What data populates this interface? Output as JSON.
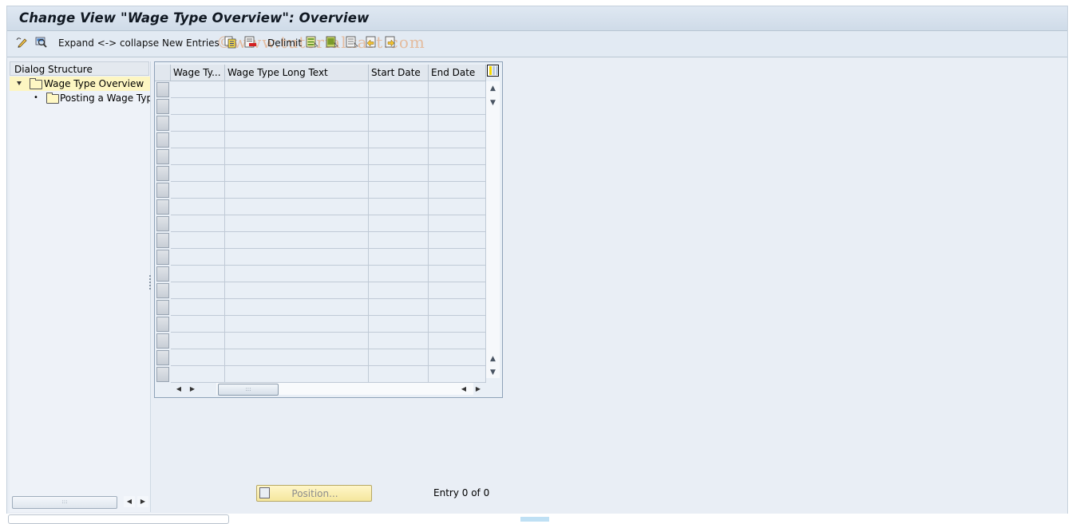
{
  "window": {
    "title": "Change View \"Wage Type Overview\": Overview",
    "watermark": "©www.tutorialkart.com"
  },
  "toolbar": {
    "items": [
      {
        "type": "icon",
        "name": "display-change-icon"
      },
      {
        "type": "icon",
        "name": "find-icon"
      },
      {
        "type": "button",
        "label": "Expand <-> collapse"
      },
      {
        "type": "button",
        "label": "New Entries"
      },
      {
        "type": "icon",
        "name": "copy-as-icon"
      },
      {
        "type": "icon",
        "name": "delete-icon"
      },
      {
        "type": "button",
        "label": "Delimit"
      },
      {
        "type": "icon",
        "name": "select-all-icon"
      },
      {
        "type": "icon",
        "name": "select-block-icon"
      },
      {
        "type": "icon",
        "name": "deselect-all-icon"
      },
      {
        "type": "icon",
        "name": "previous-entry-icon"
      },
      {
        "type": "icon",
        "name": "next-entry-icon"
      }
    ],
    "expand_label": "Expand <-> collapse",
    "new_entries_label": "New Entries",
    "delimit_label": "Delimit"
  },
  "dialog_structure": {
    "header": "Dialog Structure",
    "nodes": [
      {
        "label": "Wage Type Overview",
        "level": 0,
        "expanded": true,
        "selected": true
      },
      {
        "label": "Posting a Wage Type",
        "level": 1,
        "expanded": false,
        "selected": false
      }
    ]
  },
  "table": {
    "columns": [
      "Wage Ty...",
      "Wage Type Long Text",
      "Start Date",
      "End Date"
    ],
    "row_count_visible": 18,
    "rows": []
  },
  "footer": {
    "position_label": "Position...",
    "entry_text": "Entry 0 of 0"
  }
}
